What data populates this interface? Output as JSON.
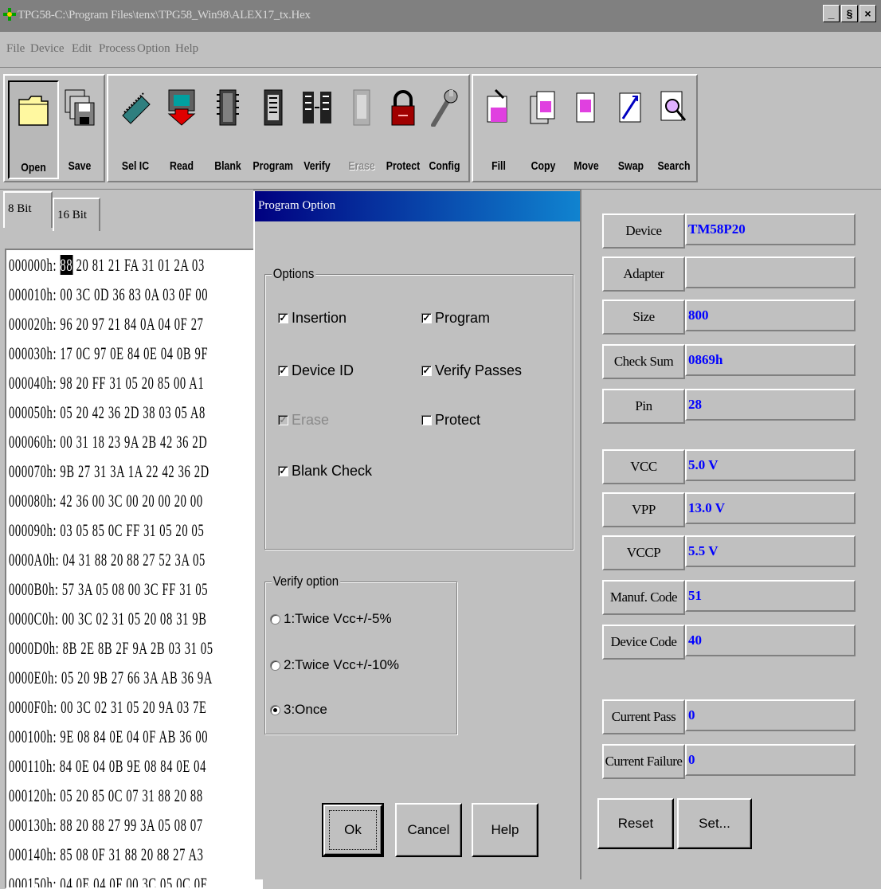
{
  "window": {
    "title": "TPG58-C:\\Program Files\\tenx\\TPG58_Win98\\ALEX17_tx.Hex",
    "minimize": "_",
    "restore": "§",
    "close": "×"
  },
  "menu": [
    "File",
    "Device",
    "Edit",
    "Process",
    "Option",
    "Help"
  ],
  "toolbar": {
    "open": "Open",
    "save": "Save",
    "sel_ic": "Sel IC",
    "read": "Read",
    "blank": "Blank",
    "program": "Program",
    "verify": "Verify",
    "erase": "Erase",
    "protect": "Protect",
    "config": "Config",
    "fill": "Fill",
    "copy": "Copy",
    "move": "Move",
    "swap": "Swap",
    "search": "Search"
  },
  "tabs": [
    "8 Bit",
    "16 Bit"
  ],
  "hex_rows": [
    {
      "addr": "000000h:",
      "first": "88",
      "rest": "20 81 21 FA 31 01 2A 03"
    },
    {
      "addr": "000010h:",
      "first": "00",
      "rest": "3C 0D 36 83 0A 03 0F 00"
    },
    {
      "addr": "000020h:",
      "first": "96",
      "rest": "20 97 21 84 0A 04 0F 27"
    },
    {
      "addr": "000030h:",
      "first": "17",
      "rest": "0C 97 0E 84 0E 04 0B 9F"
    },
    {
      "addr": "000040h:",
      "first": "98",
      "rest": "20 FF 31 05 20 85 00 A1"
    },
    {
      "addr": "000050h:",
      "first": "05",
      "rest": "20 42 36 2D 38 03 05 A8"
    },
    {
      "addr": "000060h:",
      "first": "00",
      "rest": "31 18 23 9A 2B 42 36 2D"
    },
    {
      "addr": "000070h:",
      "first": "9B",
      "rest": "27 31 3A 1A 22 42 36 2D"
    },
    {
      "addr": "000080h:",
      "first": "42",
      "rest": "36 00 3C 00 20 00 20 00"
    },
    {
      "addr": "000090h:",
      "first": "03",
      "rest": "05 85 0C FF 31 05 20 05"
    },
    {
      "addr": "0000A0h:",
      "first": "04",
      "rest": "31 88 20 88 27 52 3A 05"
    },
    {
      "addr": "0000B0h:",
      "first": "57",
      "rest": "3A 05 08 00 3C FF 31 05"
    },
    {
      "addr": "0000C0h:",
      "first": "00",
      "rest": "3C 02 31 05 20 08 31 9B"
    },
    {
      "addr": "0000D0h:",
      "first": "8B",
      "rest": "2E 8B 2F 9A 2B 03 31 05"
    },
    {
      "addr": "0000E0h:",
      "first": "05",
      "rest": "20 9B 27 66 3A AB 36 9A"
    },
    {
      "addr": "0000F0h:",
      "first": "00",
      "rest": "3C 02 31 05 20 9A 03 7E"
    },
    {
      "addr": "000100h:",
      "first": "9E",
      "rest": "08 84 0E 04 0F AB 36 00"
    },
    {
      "addr": "000110h:",
      "first": "84",
      "rest": "0E 04 0B 9E 08 84 0E 04"
    },
    {
      "addr": "000120h:",
      "first": "05",
      "rest": "20 85 0C 07 31 88 20 88"
    },
    {
      "addr": "000130h:",
      "first": "88",
      "rest": "20 88 27 99 3A 05 08 07"
    },
    {
      "addr": "000140h:",
      "first": "85",
      "rest": "08 0F 31 88 20 88 27 A3"
    },
    {
      "addr": "000150h:",
      "first": "04",
      "rest": "0E 04 0F 00 3C 05 0C 0F"
    }
  ],
  "dialog": {
    "title": "Program Option",
    "options_label": "Options",
    "options": [
      {
        "label": "Insertion",
        "checked": true,
        "disabled": false
      },
      {
        "label": "Program",
        "checked": true,
        "disabled": false
      },
      {
        "label": "Device ID",
        "checked": true,
        "disabled": false
      },
      {
        "label": "Verify Passes",
        "checked": true,
        "disabled": false
      },
      {
        "label": "Erase",
        "checked": true,
        "disabled": true
      },
      {
        "label": "Protect",
        "checked": false,
        "disabled": false
      },
      {
        "label": "Blank Check",
        "checked": true,
        "disabled": false
      }
    ],
    "verify_label": "Verify option",
    "verify": [
      {
        "label": "1:Twice Vcc+/-5%",
        "selected": false
      },
      {
        "label": "2:Twice Vcc+/-10%",
        "selected": false
      },
      {
        "label": "3:Once",
        "selected": true
      }
    ],
    "ok": "Ok",
    "cancel": "Cancel",
    "help": "Help"
  },
  "info": {
    "device_label": "Device",
    "device": "TM58P20",
    "adapter_label": "Adapter",
    "adapter": "",
    "size_label": "Size",
    "size": "800",
    "checksum_label": "Check Sum",
    "checksum": "0869h",
    "pin_label": "Pin",
    "pin": "28",
    "vcc_label": "VCC",
    "vcc": "5.0 V",
    "vpp_label": "VPP",
    "vpp": "13.0 V",
    "vccp_label": "VCCP",
    "vccp": "5.5 V",
    "manuf_label": "Manuf. Code",
    "manuf": "51",
    "devcode_label": "Device Code",
    "devcode": "40",
    "curpass_label": "Current Pass",
    "curpass": "0",
    "curfail_label": "Current Failure",
    "curfail": "0",
    "reset": "Reset",
    "set": "Set..."
  },
  "colors": {
    "title_active_start": "#000080",
    "title_active_end": "#1084d0",
    "value_text": "#0000ff"
  }
}
